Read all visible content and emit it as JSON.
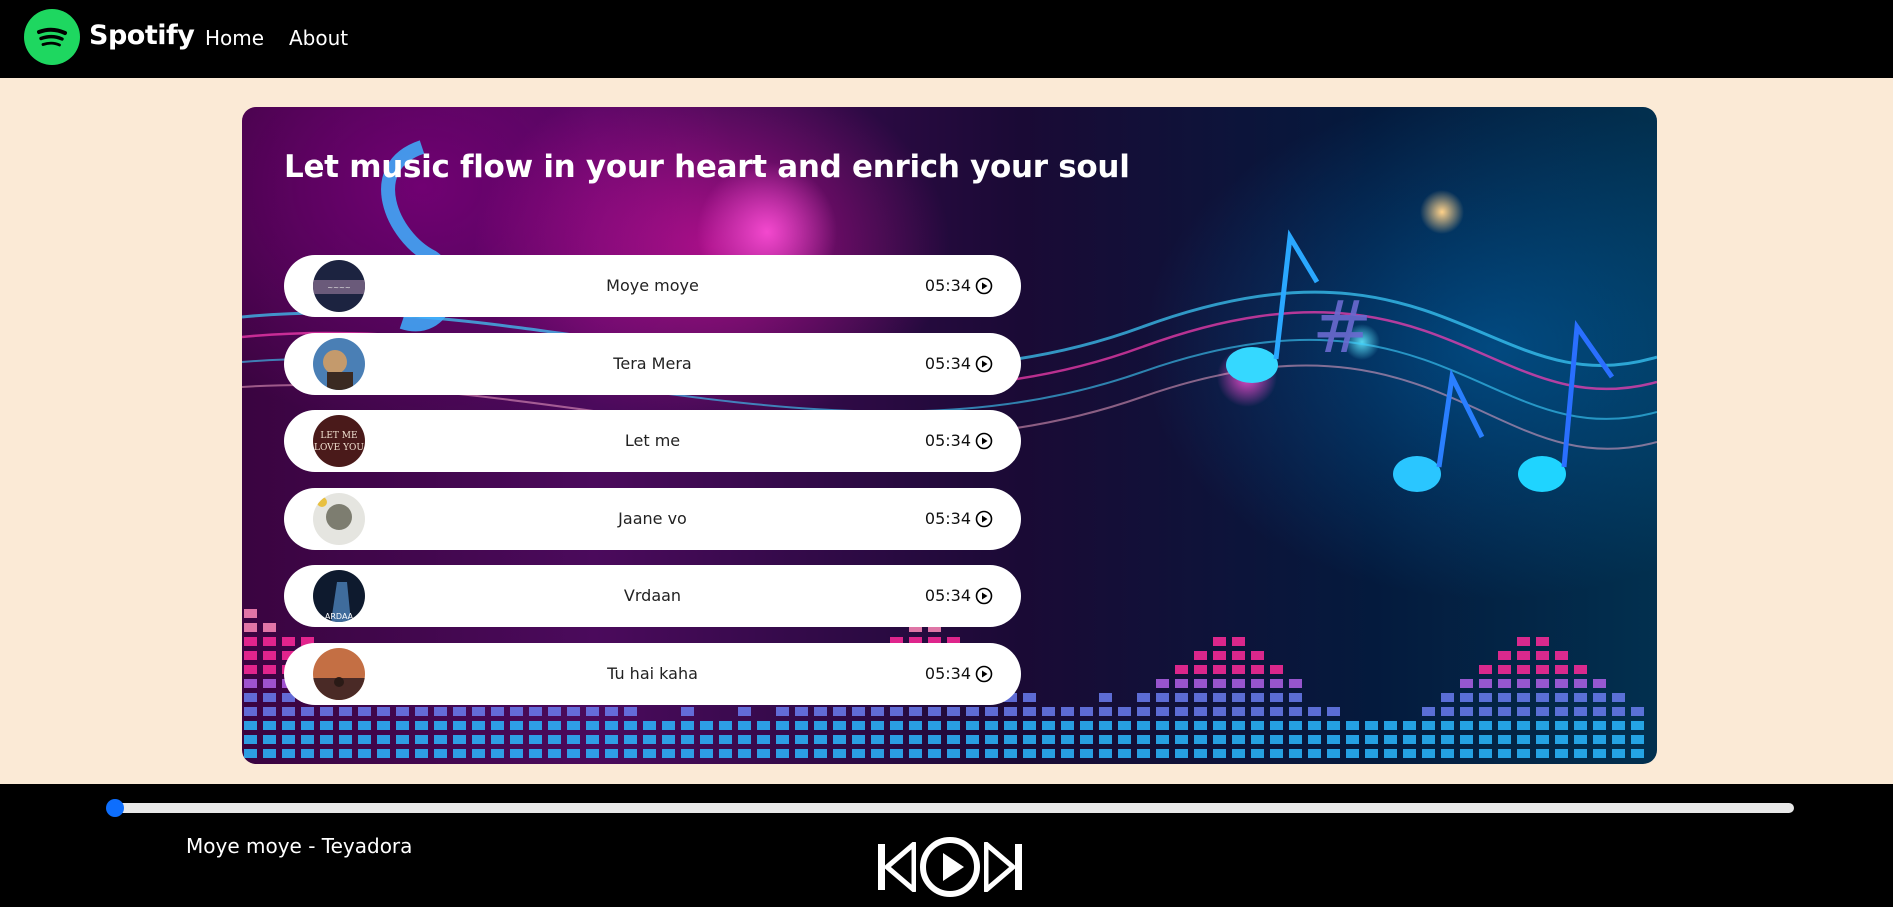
{
  "nav": {
    "brand": "Spotify",
    "links": [
      "Home",
      "About"
    ],
    "logo_color": "#1ed760"
  },
  "hero": {
    "title": "Let music flow in your heart and enrich your soul",
    "songs": [
      {
        "name": "Moye moye",
        "duration": "05:34",
        "cover_colors": [
          "#1c2340",
          "#6a5a7a"
        ]
      },
      {
        "name": "Tera Mera",
        "duration": "05:34",
        "cover_colors": [
          "#4a7fb5",
          "#c49a6c"
        ]
      },
      {
        "name": "Let me",
        "duration": "05:34",
        "cover_colors": [
          "#4a1a1a",
          "#8c3b2f"
        ]
      },
      {
        "name": "Jaane vo",
        "duration": "05:34",
        "cover_colors": [
          "#e5e5e0",
          "#7d7d70"
        ]
      },
      {
        "name": "Vrdaan",
        "duration": "05:34",
        "cover_colors": [
          "#0e1a2e",
          "#3f6c9c"
        ]
      },
      {
        "name": "Tu hai kaha",
        "duration": "05:34",
        "cover_colors": [
          "#c46f44",
          "#4a2a26"
        ]
      }
    ],
    "play_icon": "play-circle-icon"
  },
  "player": {
    "now_playing": "Moye moye - Teyadora",
    "progress": 0,
    "accent_color": "#0d6efd",
    "controls": [
      "previous-icon",
      "play-icon",
      "next-icon"
    ]
  }
}
